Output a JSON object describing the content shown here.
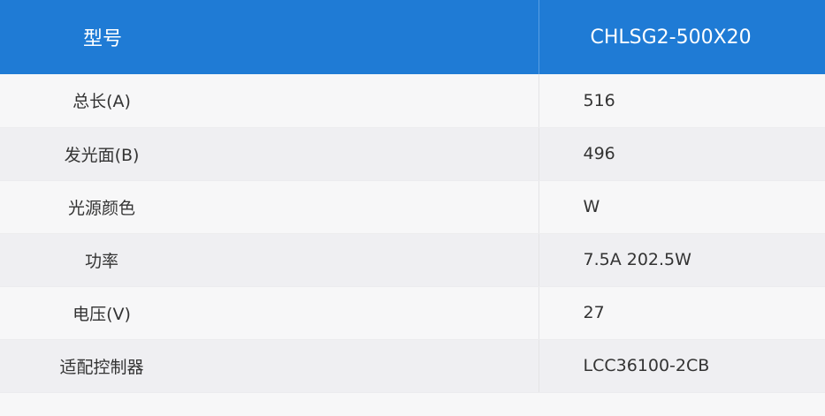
{
  "header": {
    "col1": "型号",
    "col2": "CHLSG2-500X20"
  },
  "rows": [
    {
      "label": "总长(A)",
      "value": "516"
    },
    {
      "label": "发光面(B)",
      "value": "496"
    },
    {
      "label": "光源颜色",
      "value": "W"
    },
    {
      "label": "功率",
      "value": "7.5A  202.5W"
    },
    {
      "label": "电压(V)",
      "value": "27"
    },
    {
      "label": "适配控制器",
      "value": "LCC36100-2CB"
    }
  ]
}
